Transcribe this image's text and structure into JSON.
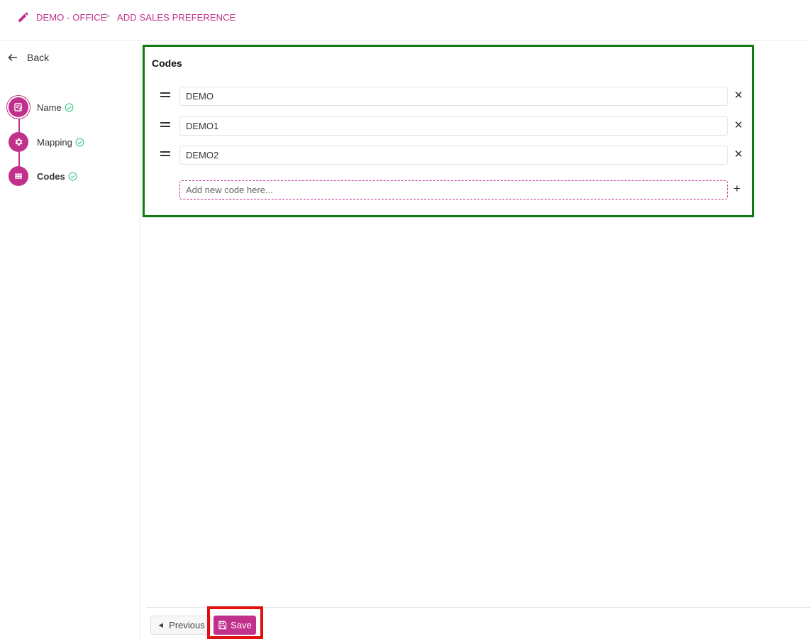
{
  "breadcrumb": {
    "items": [
      "DEMO - OFFICE",
      "ADD SALES PREFERENCE"
    ],
    "separator": ">",
    "icon": "pencil-icon"
  },
  "sidebar": {
    "back_label": "Back",
    "steps": [
      {
        "label": "Name",
        "icon": "edit-note-icon",
        "completed": true
      },
      {
        "label": "Mapping",
        "icon": "gear-icon",
        "completed": true
      },
      {
        "label": "Codes",
        "icon": "list-icon",
        "completed": true,
        "current": true
      }
    ]
  },
  "codes": {
    "title": "Codes",
    "items": [
      "DEMO",
      "DEMO1",
      "DEMO2"
    ],
    "new_placeholder": "Add new code here..."
  },
  "footer": {
    "previous_label": "Previous",
    "save_label": "Save"
  },
  "colors": {
    "accent": "#c1308a",
    "check": "#3ec98a",
    "highlight_green": "#127a12",
    "highlight_red": "#e30f0f"
  }
}
